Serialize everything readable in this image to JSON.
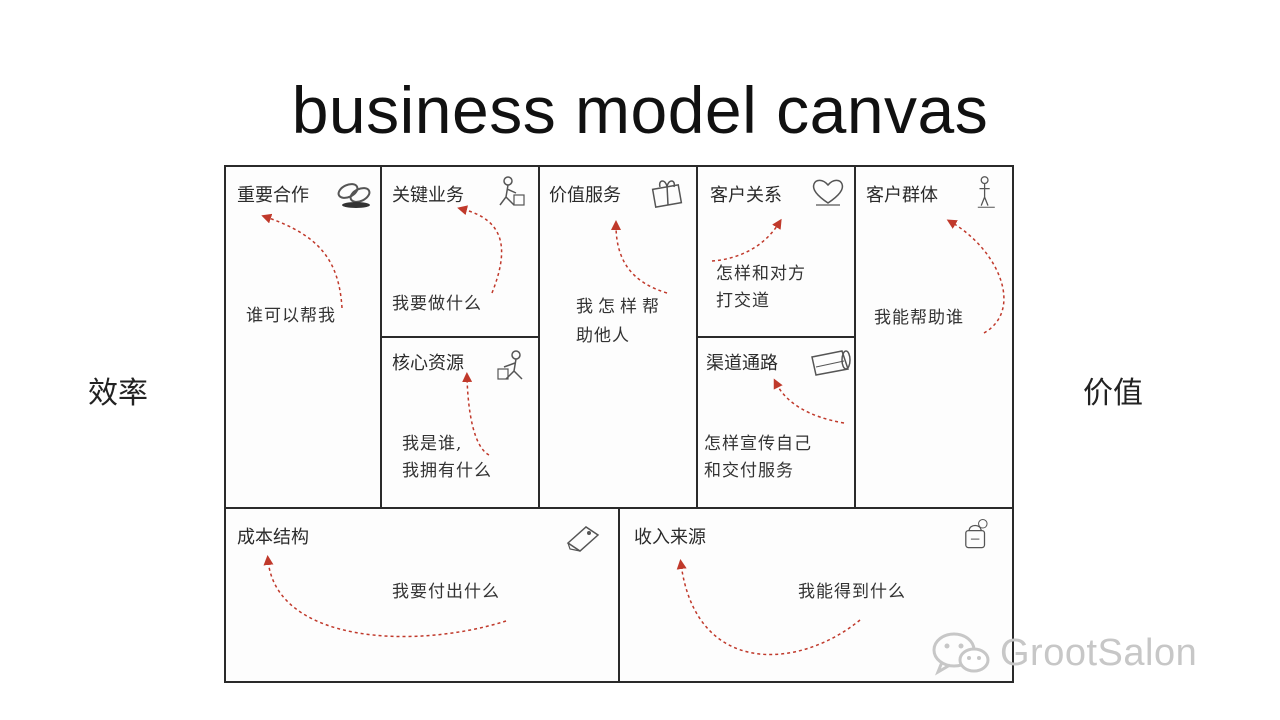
{
  "title": "business model canvas",
  "side_labels": {
    "left": "效率",
    "right": "价值"
  },
  "blocks": {
    "key_partners": {
      "title": "重要合作",
      "note": "谁可以帮我",
      "icon": "chain-link-icon"
    },
    "key_activities": {
      "title": "关键业务",
      "note": "我要做什么",
      "icon": "worker-icon"
    },
    "key_resources": {
      "title": "核心资源",
      "note_line1": "我是谁,",
      "note_line2": "我拥有什么",
      "icon": "worker-icon"
    },
    "value_propositions": {
      "title": "价值服务",
      "note_line1": "我怎样帮",
      "note_line2": "助他人",
      "icon": "gift-icon"
    },
    "customer_relationships": {
      "title": "客户关系",
      "note_line1": "怎样和对方",
      "note_line2": "打交道",
      "icon": "heart-icon"
    },
    "channels": {
      "title": "渠道通路",
      "note_line1": "怎样宣传自己",
      "note_line2": "和交付服务",
      "icon": "truck-icon"
    },
    "customer_segments": {
      "title": "客户群体",
      "note": "我能帮助谁",
      "icon": "person-icon"
    },
    "cost_structure": {
      "title": "成本结构",
      "note": "我要付出什么",
      "icon": "price-tag-icon"
    },
    "revenue_streams": {
      "title": "收入来源",
      "note": "我能得到什么",
      "icon": "money-bag-icon"
    }
  },
  "watermark": {
    "text": "GrootSalon",
    "icon": "wechat-icon"
  },
  "colors": {
    "arrow": "#c0392b",
    "grid": "#2a2a2a",
    "watermark": "#c7c7c7"
  }
}
